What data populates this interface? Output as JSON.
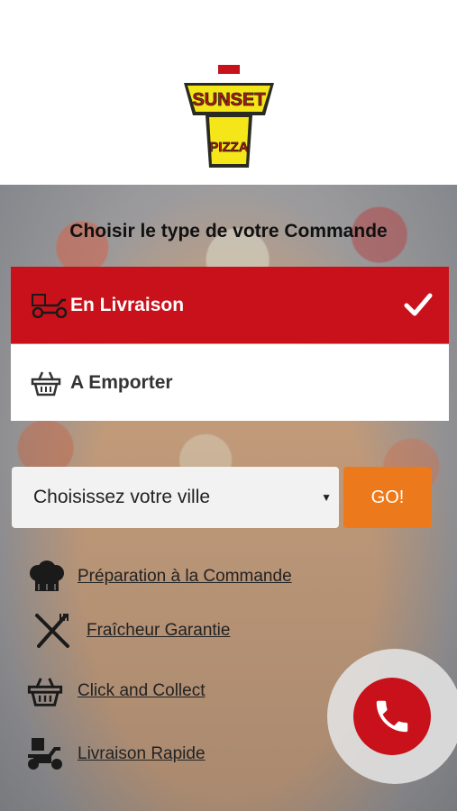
{
  "brand": {
    "logo_top": "SUNSET",
    "logo_bottom": "PIZZA"
  },
  "order": {
    "title": "Choisir le type de votre Commande",
    "options": [
      {
        "label": "En Livraison",
        "icon": "delivery-scooter-icon",
        "selected": true
      },
      {
        "label": "A Emporter",
        "icon": "basket-icon",
        "selected": false
      }
    ]
  },
  "city": {
    "placeholder": "Choisissez votre ville",
    "go_label": "GO!"
  },
  "features": [
    {
      "label": "Préparation à la Commande",
      "icon": "chef-hat-icon"
    },
    {
      "label": "Fraîcheur Garantie",
      "icon": "fork-knife-icon"
    },
    {
      "label": "Click and Collect",
      "icon": "basket-icon"
    },
    {
      "label": "Livraison Rapide",
      "icon": "delivery-scooter-icon"
    }
  ],
  "colors": {
    "primary": "#c8111b",
    "accent": "#ec7a1d"
  }
}
